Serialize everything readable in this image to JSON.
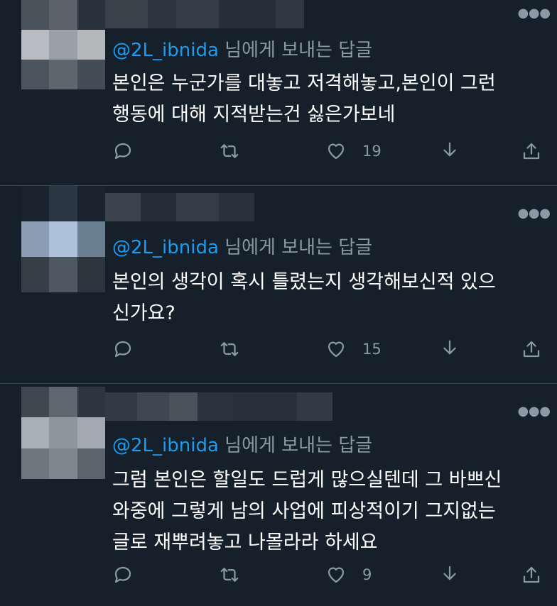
{
  "tweets": [
    {
      "reply_prefix": "@2L_ibnida",
      "reply_suffix": " 님에게 보내는 답글",
      "text": "본인은 누군가를 대놓고 저격해놓고,본인이 그런\n행동에 대해 지적받는건 싫은가보네",
      "like_count": "19"
    },
    {
      "reply_prefix": "@2L_ibnida",
      "reply_suffix": " 님에게 보내는 답글",
      "text": "본인의 생각이 혹시 틀렸는지 생각해보신적 있으\n신가요?",
      "like_count": "15"
    },
    {
      "reply_prefix": "@2L_ibnida",
      "reply_suffix": " 님에게 보내는 답글",
      "text": "그럼 본인은 할일도 드럽게 많으실텐데 그 바쁘신\n와중에 그렇게 남의 사업에 피상적이기 그지없는\n글로 재뿌려놓고 나몰라라 하세요",
      "like_count": "9"
    }
  ],
  "icons": {
    "more": "more-icon",
    "reply": "reply-icon",
    "retweet": "retweet-icon",
    "like": "heart-icon",
    "download": "download-icon",
    "share": "share-icon"
  },
  "colors": {
    "background": "#15202b",
    "handle": "#1d9bf0",
    "muted": "#8b98a5",
    "divider": "#38444d"
  }
}
